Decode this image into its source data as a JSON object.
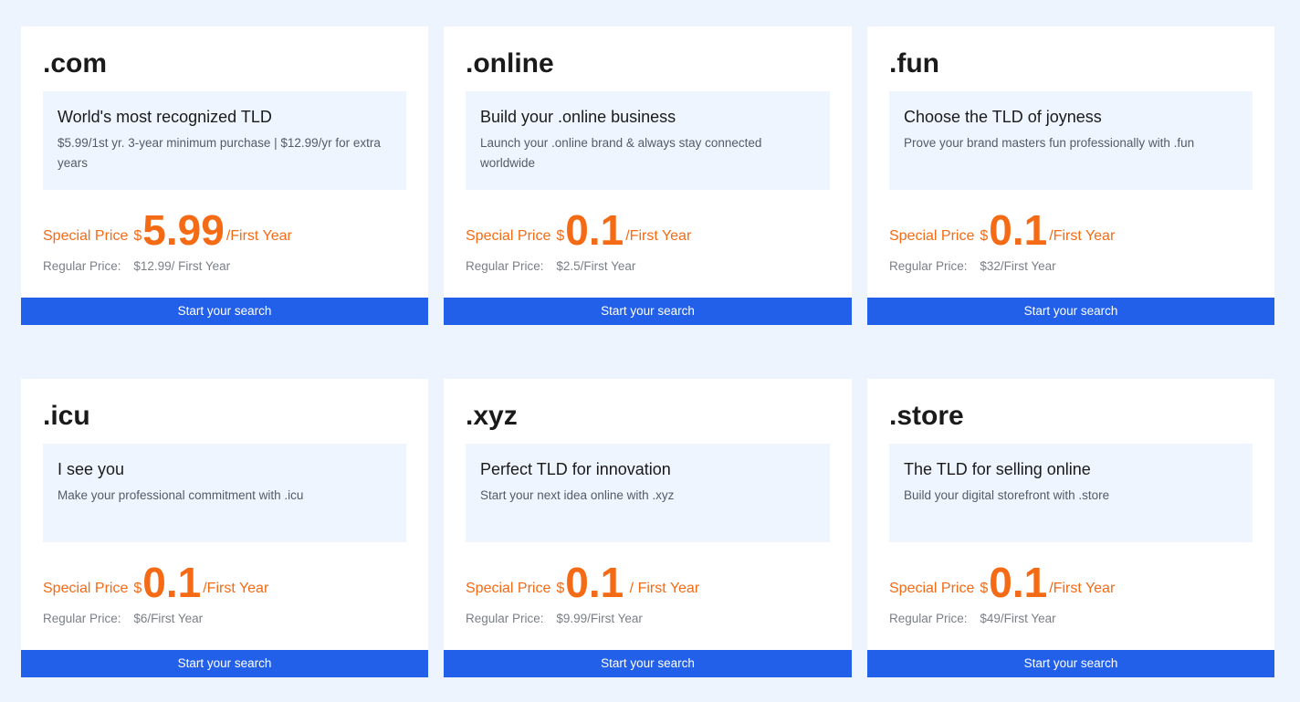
{
  "colors": {
    "page_background": "#eef4fe",
    "card_background": "#ffffff",
    "description_background": "#eff5fe",
    "accent_orange": "#f56a14",
    "button_blue": "#2260ea"
  },
  "cards": [
    {
      "tld": ".com",
      "title": "World's most recognized TLD",
      "description": "$5.99/1st yr. 3-year minimum purchase | $12.99/yr for extra years",
      "special_label": "Special Price",
      "currency": "$",
      "special_price": "5.99",
      "special_unit": "/First Year",
      "regular_label": "Regular Price:",
      "regular_price": "$12.99/ First Year",
      "button_label": "Start your search"
    },
    {
      "tld": ".online",
      "title": "Build your .online business",
      "description": "Launch your .online brand & always stay connected worldwide",
      "special_label": "Special Price",
      "currency": "$",
      "special_price": "0.1",
      "special_unit": "/First Year",
      "regular_label": "Regular Price:",
      "regular_price": "$2.5/First Year",
      "button_label": "Start your search"
    },
    {
      "tld": ".fun",
      "title": "Choose the TLD of joyness",
      "description": "Prove your brand masters fun professionally with .fun",
      "special_label": "Special Price",
      "currency": "$",
      "special_price": "0.1",
      "special_unit": "/First Year",
      "regular_label": "Regular Price:",
      "regular_price": "$32/First Year",
      "button_label": "Start your search"
    },
    {
      "tld": ".icu",
      "title": "I see you",
      "description": "Make your professional commitment with .icu",
      "special_label": "Special Price",
      "currency": "$",
      "special_price": "0.1",
      "special_unit": "/First Year",
      "regular_label": "Regular Price:",
      "regular_price": "$6/First Year",
      "button_label": "Start your search"
    },
    {
      "tld": ".xyz",
      "title": "Perfect TLD for innovation",
      "description": "Start your next idea online with .xyz",
      "special_label": "Special Price",
      "currency": "$",
      "special_price": "0.1",
      "special_unit": " / First Year",
      "regular_label": "Regular Price:",
      "regular_price": "$9.99/First Year",
      "button_label": "Start your search"
    },
    {
      "tld": ".store",
      "title": "The TLD for selling online",
      "description": "Build your digital storefront with .store",
      "special_label": "Special Price",
      "currency": "$",
      "special_price": "0.1",
      "special_unit": "/First Year",
      "regular_label": "Regular Price:",
      "regular_price": "$49/First Year",
      "button_label": "Start your search"
    }
  ]
}
